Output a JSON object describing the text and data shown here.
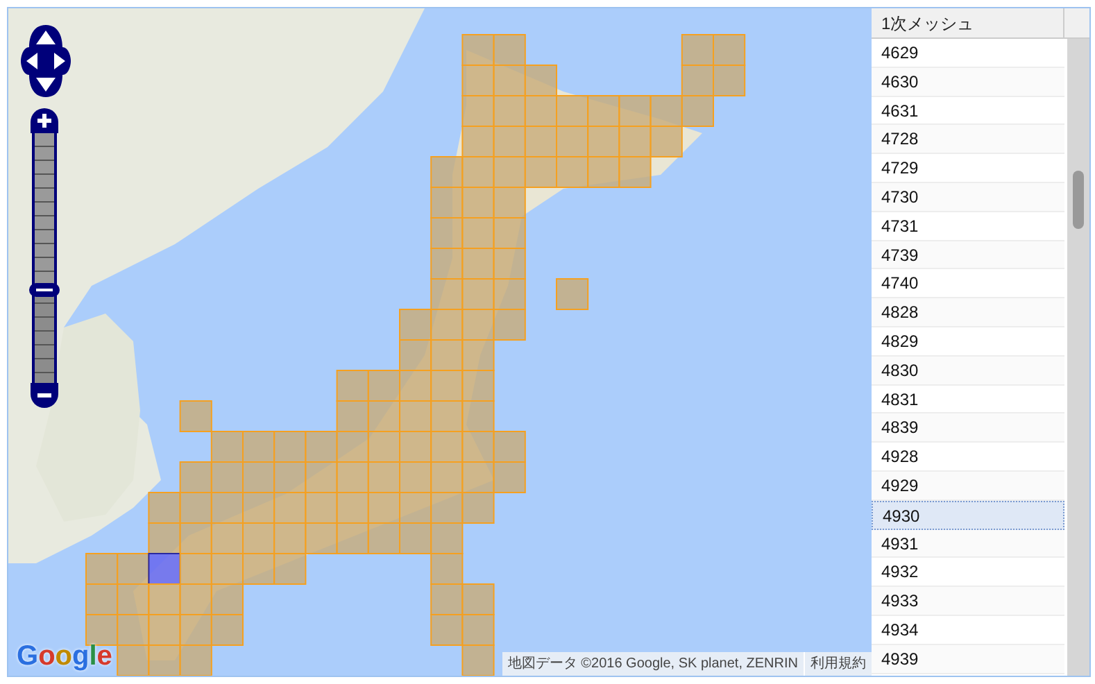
{
  "map": {
    "zoom": {
      "level": 0.37
    },
    "logo": "Google",
    "attribution": "地図データ ©2016 Google, SK planet, ZENRIN",
    "terms_link": "利用規約"
  },
  "mesh_list": {
    "column": "1次メッシュ",
    "rows": [
      {
        "code": "4629",
        "selected": false
      },
      {
        "code": "4630",
        "selected": false
      },
      {
        "code": "4631",
        "selected": false
      },
      {
        "code": "4728",
        "selected": false
      },
      {
        "code": "4729",
        "selected": false
      },
      {
        "code": "4730",
        "selected": false
      },
      {
        "code": "4731",
        "selected": false
      },
      {
        "code": "4739",
        "selected": false
      },
      {
        "code": "4740",
        "selected": false
      },
      {
        "code": "4828",
        "selected": false
      },
      {
        "code": "4829",
        "selected": false
      },
      {
        "code": "4830",
        "selected": false
      },
      {
        "code": "4831",
        "selected": false
      },
      {
        "code": "4839",
        "selected": false
      },
      {
        "code": "4928",
        "selected": false
      },
      {
        "code": "4929",
        "selected": false
      },
      {
        "code": "4930",
        "selected": true
      },
      {
        "code": "4931",
        "selected": false
      },
      {
        "code": "4932",
        "selected": false
      },
      {
        "code": "4933",
        "selected": false
      },
      {
        "code": "4934",
        "selected": false
      },
      {
        "code": "4939",
        "selected": false
      }
    ]
  }
}
